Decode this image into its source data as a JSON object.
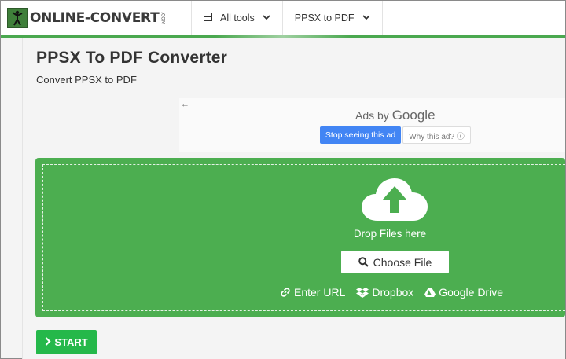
{
  "header": {
    "logo_text": "ONLINE-CONVERT",
    "logo_com": ".COM",
    "nav": [
      {
        "label": "All tools"
      },
      {
        "label": "PPSX to PDF"
      }
    ]
  },
  "main": {
    "title": "PPSX To PDF Converter",
    "subtitle": "Convert PPSX to PDF"
  },
  "ad": {
    "ads_by": "Ads by",
    "google": "Google",
    "stop_label": "Stop seeing this ad",
    "why_label": "Why this ad? ⓘ"
  },
  "dropzone": {
    "drop_text": "Drop Files here",
    "choose_label": "Choose File",
    "sources": [
      {
        "label": "Enter URL",
        "icon": "link-icon"
      },
      {
        "label": "Dropbox",
        "icon": "dropbox-icon"
      },
      {
        "label": "Google Drive",
        "icon": "google-drive-icon"
      }
    ]
  },
  "actions": {
    "start_label": "START"
  },
  "colors": {
    "brand_green": "#4cae50",
    "start_green": "#25b84a",
    "google_blue": "#4285f4"
  }
}
